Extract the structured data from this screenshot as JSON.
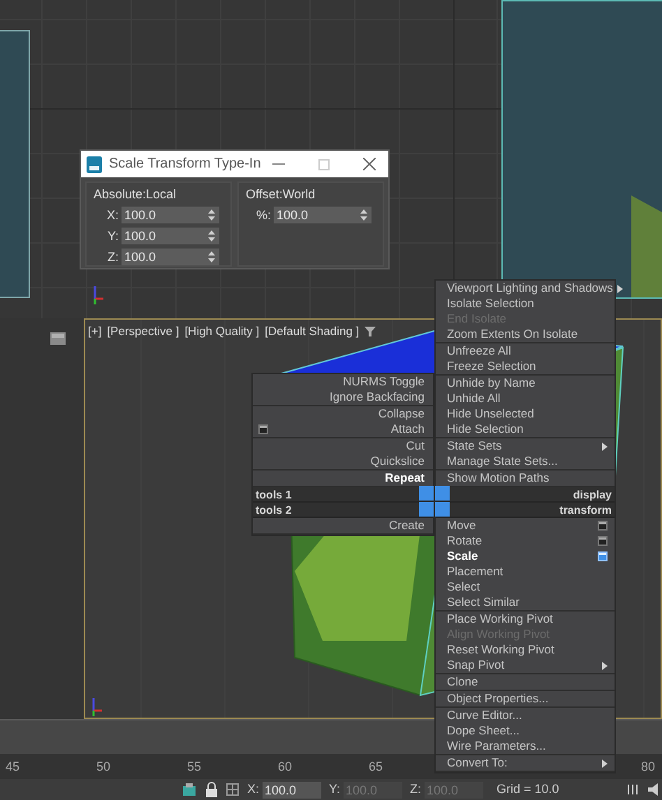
{
  "dialog": {
    "title": "Scale Transform Type-In",
    "groups": [
      {
        "label": "Absolute:Local",
        "fields": [
          {
            "label": "X:",
            "value": "100.0"
          },
          {
            "label": "Y:",
            "value": "100.0"
          },
          {
            "label": "Z:",
            "value": "100.0"
          }
        ]
      },
      {
        "label": "Offset:World",
        "fields": [
          {
            "label": "%:",
            "value": "100.0"
          }
        ]
      }
    ]
  },
  "viewport": {
    "labels": [
      "[+]",
      "[Perspective ]",
      "[High Quality ]",
      "[Default Shading ]"
    ]
  },
  "quad_left": {
    "top_sections": [
      [
        {
          "label": "NURMS Toggle",
          "kind": "plain",
          "disabled": false,
          "bold": false
        },
        {
          "label": "Ignore Backfacing",
          "kind": "plain",
          "disabled": false,
          "bold": false
        }
      ],
      [
        {
          "label": "Collapse",
          "kind": "plain",
          "disabled": false,
          "bold": false
        },
        {
          "label": "Attach",
          "kind": "tool",
          "disabled": false,
          "bold": false
        }
      ],
      [
        {
          "label": "Cut",
          "kind": "plain",
          "disabled": false,
          "bold": false
        },
        {
          "label": "Quickslice",
          "kind": "plain",
          "disabled": false,
          "bold": false
        }
      ],
      [
        {
          "label": "Repeat",
          "kind": "plain",
          "disabled": false,
          "bold": true
        }
      ]
    ],
    "headers": [
      "tools 1",
      "tools 2"
    ],
    "bottom_sections": [
      [
        {
          "label": "Create",
          "kind": "plain",
          "disabled": false,
          "bold": false
        }
      ]
    ]
  },
  "quad_right": {
    "top_sections": [
      [
        {
          "label": "Viewport Lighting and Shadows",
          "kind": "submenu",
          "disabled": false,
          "bold": false
        },
        {
          "label": "Isolate Selection",
          "kind": "plain",
          "disabled": false,
          "bold": false
        },
        {
          "label": "End Isolate",
          "kind": "plain",
          "disabled": true,
          "bold": false
        },
        {
          "label": "Zoom Extents On Isolate",
          "kind": "plain",
          "disabled": false,
          "bold": false
        }
      ],
      [
        {
          "label": "Unfreeze All",
          "kind": "plain",
          "disabled": false,
          "bold": false
        },
        {
          "label": "Freeze Selection",
          "kind": "plain",
          "disabled": false,
          "bold": false
        }
      ],
      [
        {
          "label": "Unhide by Name",
          "kind": "plain",
          "disabled": false,
          "bold": false
        },
        {
          "label": "Unhide All",
          "kind": "plain",
          "disabled": false,
          "bold": false
        },
        {
          "label": "Hide Unselected",
          "kind": "plain",
          "disabled": false,
          "bold": false
        },
        {
          "label": "Hide Selection",
          "kind": "plain",
          "disabled": false,
          "bold": false
        }
      ],
      [
        {
          "label": "State Sets",
          "kind": "submenu",
          "disabled": false,
          "bold": false
        },
        {
          "label": "Manage State Sets...",
          "kind": "plain",
          "disabled": false,
          "bold": false
        }
      ],
      [
        {
          "label": "Show Motion Paths",
          "kind": "plain",
          "disabled": false,
          "bold": false
        }
      ]
    ],
    "headers": [
      "display",
      "transform"
    ],
    "bottom_sections": [
      [
        {
          "label": "Move",
          "kind": "tool",
          "disabled": false,
          "bold": false
        },
        {
          "label": "Rotate",
          "kind": "tool",
          "disabled": false,
          "bold": false
        },
        {
          "label": "Scale",
          "kind": "tool",
          "disabled": false,
          "bold": true
        },
        {
          "label": "Placement",
          "kind": "plain",
          "disabled": false,
          "bold": false
        },
        {
          "label": "Select",
          "kind": "plain",
          "disabled": false,
          "bold": false
        },
        {
          "label": "Select Similar",
          "kind": "plain",
          "disabled": false,
          "bold": false
        }
      ],
      [
        {
          "label": "Place Working Pivot",
          "kind": "plain",
          "disabled": false,
          "bold": false
        },
        {
          "label": "Align Working Pivot",
          "kind": "plain",
          "disabled": true,
          "bold": false
        },
        {
          "label": "Reset Working Pivot",
          "kind": "plain",
          "disabled": false,
          "bold": false
        },
        {
          "label": "Snap Pivot",
          "kind": "submenu",
          "disabled": false,
          "bold": false
        }
      ],
      [
        {
          "label": "Clone",
          "kind": "plain",
          "disabled": false,
          "bold": false
        }
      ],
      [
        {
          "label": "Object Properties...",
          "kind": "plain",
          "disabled": false,
          "bold": false
        }
      ],
      [
        {
          "label": "Curve Editor...",
          "kind": "plain",
          "disabled": false,
          "bold": false
        },
        {
          "label": "Dope Sheet...",
          "kind": "plain",
          "disabled": false,
          "bold": false
        },
        {
          "label": "Wire Parameters...",
          "kind": "plain",
          "disabled": false,
          "bold": false
        }
      ],
      [
        {
          "label": "Convert To:",
          "kind": "submenu",
          "disabled": false,
          "bold": false
        }
      ]
    ]
  },
  "timeline": {
    "ticks": [
      "45",
      "50",
      "55",
      "60",
      "65",
      "80"
    ]
  },
  "status_bar": {
    "fields": [
      {
        "label": "X:",
        "value": "100.0",
        "disabled": false
      },
      {
        "label": "Y:",
        "value": "100.0",
        "disabled": true
      },
      {
        "label": "Z:",
        "value": "100.0",
        "disabled": true
      }
    ],
    "grid": "Grid = 10.0"
  }
}
